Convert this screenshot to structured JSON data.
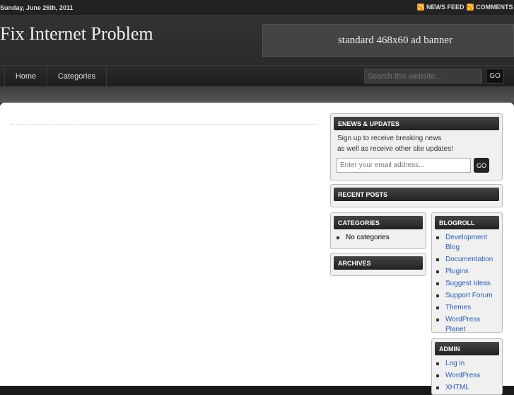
{
  "topbar": {
    "date": "Sunday, June 26th, 2011",
    "news_feed": "NEWS FEED",
    "comments": "COMMENTS"
  },
  "header": {
    "site_title": "Fix Internet Problem",
    "ad_banner": "standard 468x60 ad banner"
  },
  "nav": {
    "items": [
      {
        "label": "Home"
      },
      {
        "label": "Categories"
      }
    ],
    "search_placeholder": "Search this website...",
    "search_button": "GO"
  },
  "sidebar": {
    "enews": {
      "title": "ENEWS & UPDATES",
      "line1": "Sign up to receive breaking news",
      "line2": "as well as receive other site updates!",
      "email_placeholder": "Enter your email address...",
      "button": "GO"
    },
    "recent_posts": {
      "title": "RECENT POSTS"
    },
    "categories": {
      "title": "CATEGORIES",
      "items": [
        "No categories"
      ]
    },
    "archives": {
      "title": "ARCHIVES"
    },
    "blogroll": {
      "title": "BLOGROLL",
      "items": [
        "Development Blog",
        "Documentation",
        "Plugins",
        "Suggest Ideas",
        "Support Forum",
        "Themes",
        "WordPress Planet"
      ]
    },
    "admin": {
      "title": "ADMIN",
      "items": [
        "Log in",
        "WordPress",
        "XHTML"
      ]
    }
  },
  "colors": {
    "link": "#2a5db0",
    "rss": "#f39c12",
    "dark_bar": "#222222"
  }
}
